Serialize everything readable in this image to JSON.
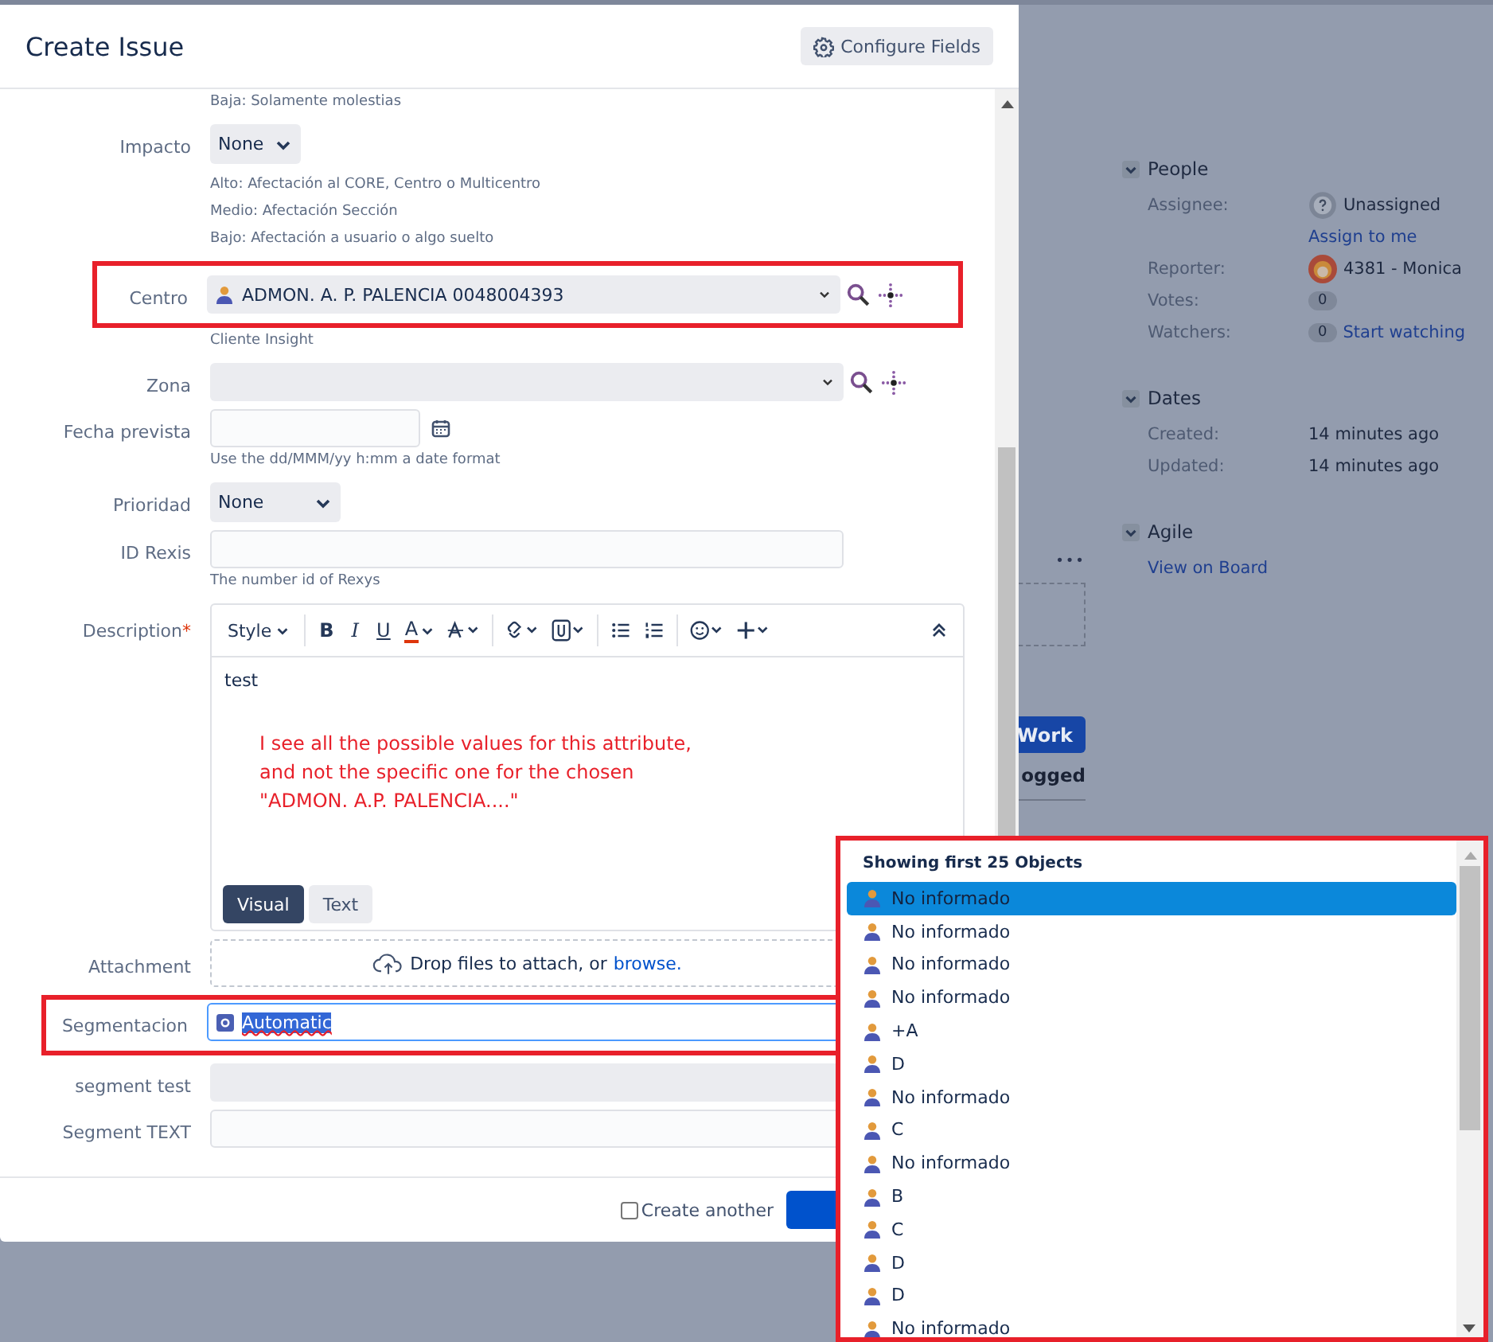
{
  "page": {
    "more": "•••",
    "button": "Work",
    "tab": "ogged",
    "sections": [
      {
        "title": "People",
        "expanded": true,
        "rows": [
          {
            "kind": "unassigned",
            "label": "Assignee:",
            "value": "Unassigned"
          },
          {
            "kind": "link",
            "value": "Assign to me"
          },
          {
            "kind": "user",
            "label": "Reporter:",
            "value": "4381 - Monica"
          },
          {
            "kind": "count",
            "label": "Votes:",
            "count": "0"
          },
          {
            "kind": "count",
            "label": "Watchers:",
            "count": "0",
            "value": "Start watching"
          }
        ]
      },
      {
        "title": "Dates",
        "expanded": true,
        "rows": [
          {
            "kind": "text",
            "label": "Created:",
            "value": "14 minutes ago"
          },
          {
            "kind": "text",
            "label": "Updated:",
            "value": "14 minutes ago"
          }
        ]
      },
      {
        "title": "Agile",
        "expanded": true,
        "rows": [
          {
            "kind": "link",
            "value": "View on Board"
          }
        ]
      }
    ]
  },
  "modal": {
    "title": "Create Issue",
    "configure": "Configure Fields",
    "fields": [
      {
        "kind": "note",
        "hints": [
          "Baja: Solamente molestias"
        ]
      },
      {
        "kind": "select",
        "label": "Impacto",
        "value": "None",
        "hints": [
          "Alto: Afectación al CORE, Centro o Multicentro",
          "Medio: Afectación Sección",
          "Bajo: Afectación a usuario o algo suelto"
        ]
      },
      {
        "kind": "insight",
        "label": "Centro",
        "value": "ADMON. A. P. PALENCIA 0048004393",
        "annotated": true,
        "hints": [
          "Cliente Insight"
        ]
      },
      {
        "kind": "insight",
        "label": "Zona"
      },
      {
        "kind": "date",
        "label": "Fecha prevista",
        "hints": [
          "Use the dd/MMM/yy h:mm a date format"
        ]
      },
      {
        "kind": "select",
        "label": "Prioridad",
        "value": "None"
      },
      {
        "kind": "text",
        "label": "ID Rexis",
        "hints": [
          "The number id of Rexys"
        ]
      },
      {
        "kind": "editor",
        "label": "Description",
        "required_mark": "*"
      },
      {
        "kind": "attachment",
        "label": "Attachment",
        "value": "Drop files to attach, or",
        "link": "browse."
      },
      {
        "kind": "focused",
        "label": "Segmentacion",
        "value": "Automatic",
        "annotated": true
      },
      {
        "kind": "combo",
        "label": "segment test"
      },
      {
        "kind": "text",
        "label": "Segment TEXT"
      }
    ],
    "editor": {
      "style": "Style",
      "buttons": [
        "B",
        "I",
        "U",
        "A"
      ],
      "content": "test",
      "note": [
        "I see all the possible values for this attribute,",
        "and not the specific one for the chosen",
        "\"ADMON. A.P. PALENCIA....\""
      ],
      "modes": [
        {
          "label": "Visual",
          "selected": true
        },
        {
          "label": "Text",
          "selected": false
        }
      ]
    },
    "create_another": {
      "label": "Create another",
      "checked": false
    }
  },
  "dropdown": {
    "header": "Showing first 25 Objects",
    "annotated": true,
    "items": [
      {
        "label": "No informado",
        "selected": true
      },
      {
        "label": "No informado",
        "selected": false
      },
      {
        "label": "No informado",
        "selected": false
      },
      {
        "label": "No informado",
        "selected": false
      },
      {
        "label": "+A",
        "selected": false
      },
      {
        "label": "D",
        "selected": false
      },
      {
        "label": "No informado",
        "selected": false
      },
      {
        "label": "C",
        "selected": false
      },
      {
        "label": "No informado",
        "selected": false
      },
      {
        "label": "B",
        "selected": false
      },
      {
        "label": "C",
        "selected": false
      },
      {
        "label": "D",
        "selected": false
      },
      {
        "label": "D",
        "selected": false
      },
      {
        "label": "No informado",
        "selected": false
      }
    ]
  }
}
